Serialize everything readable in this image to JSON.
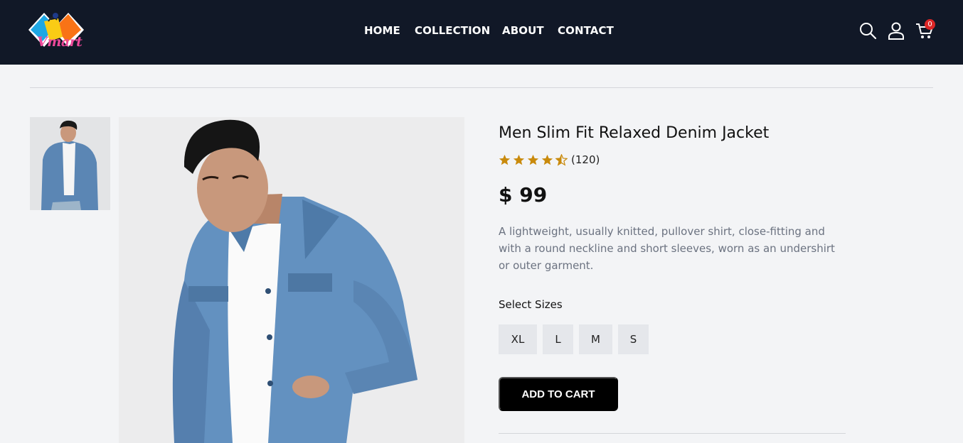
{
  "header": {
    "logo_text": "Vmart",
    "nav": [
      {
        "label": "HOME"
      },
      {
        "label": "COLLECTION"
      },
      {
        "label": "ABOUT"
      },
      {
        "label": "CONTACT"
      }
    ],
    "icons": [
      "search-icon",
      "user-icon",
      "cart-icon"
    ],
    "cart_count": "0",
    "background": "#111827"
  },
  "product": {
    "title": "Men Slim Fit Relaxed Denim Jacket",
    "rating_stars": 4.5,
    "rating_count": "(120)",
    "price": "$ 99",
    "description": "A lightweight, usually knitted, pullover shirt, close-fitting and with a round neckline and short sleeves, worn as an undershirt or outer garment.",
    "sizes_label": "Select Sizes",
    "sizes": [
      "XL",
      "L",
      "M",
      "S"
    ],
    "add_to_cart_label": "ADD TO CART",
    "star_color": "#c98a0c"
  }
}
